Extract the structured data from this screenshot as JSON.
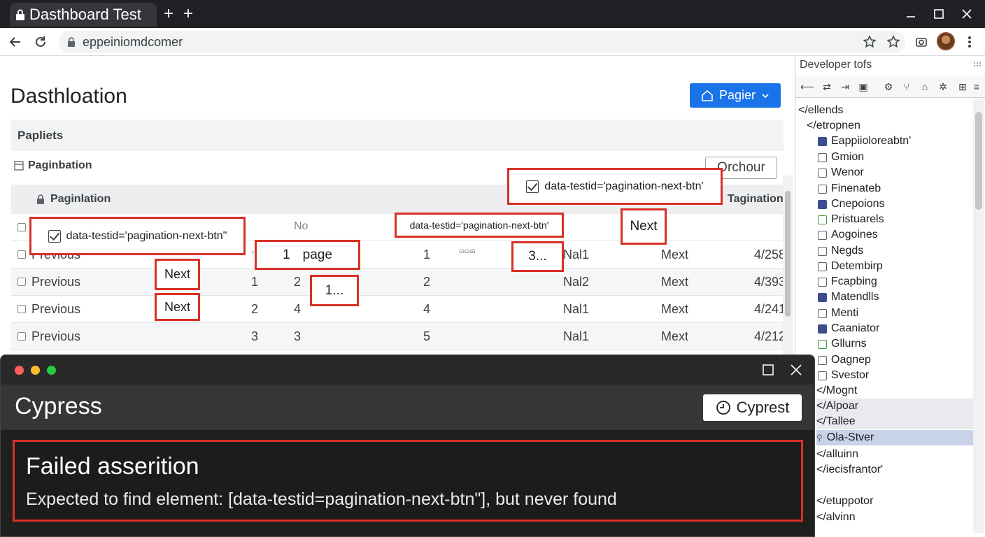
{
  "browser": {
    "tab_title": "Dasthboard Test",
    "url": "eppeiniomdcomer"
  },
  "page": {
    "title": "Dasthloation",
    "primary_button": "Pagier",
    "section_header": "Papliets",
    "subsection": "Paginbation",
    "outline_button": "Orchour",
    "grid_header_left": "Paginlation",
    "grid_header_right": "Tagination",
    "header_row": {
      "no": "No"
    },
    "rows": [
      {
        "c0": "Previous",
        "c1": "1",
        "c2": "1",
        "c3": "1",
        "c4": "Nal1",
        "c5": "Mext",
        "c6": "4/258"
      },
      {
        "c0": "Previous",
        "c1": "1",
        "c2": "2",
        "c3": "2",
        "c4": "Nal2",
        "c5": "Mext",
        "c6": "4/393"
      },
      {
        "c0": "Previous",
        "c1": "2",
        "c2": "4",
        "c3": "4",
        "c4": "Nal1",
        "c5": "Mext",
        "c6": "4/241"
      },
      {
        "c0": "Previous",
        "c1": "3",
        "c2": "3",
        "c3": "5",
        "c4": "Nal1",
        "c5": "Mext",
        "c6": "4/212"
      }
    ],
    "annotations": {
      "testid_top": "data-testid='pagination-next-btn'",
      "testid_left": "data-testid='pagination-next-btn\"",
      "testid_mid": "data-testid='pagination-next-btn'",
      "next_right": "Next",
      "page_label": "page",
      "page_num": "1",
      "three": "3...",
      "one": "1...",
      "next_a": "Next",
      "next_b": "Next"
    }
  },
  "devtools": {
    "title": "Developer tofs",
    "nodes": [
      {
        "text": "</ellends",
        "icon": ""
      },
      {
        "text": "</etropnen",
        "icon": ""
      },
      {
        "text": "Eappiioloreabtn'",
        "icon": "blue"
      },
      {
        "text": "Gmion",
        "icon": "plain"
      },
      {
        "text": "Wenor",
        "icon": "plain"
      },
      {
        "text": "Finenateb",
        "icon": "plain"
      },
      {
        "text": "Cnepoions",
        "icon": "blue"
      },
      {
        "text": "Pristuarels",
        "icon": "green"
      },
      {
        "text": "Aogoines",
        "icon": "plain"
      },
      {
        "text": "Negds",
        "icon": "plain"
      },
      {
        "text": "Detembirp",
        "icon": "plain"
      },
      {
        "text": "Fcapbing",
        "icon": "plain"
      },
      {
        "text": "Matendlls",
        "icon": "blue"
      },
      {
        "text": "Menti",
        "icon": "plain"
      },
      {
        "text": "Caaniator",
        "icon": "blue"
      },
      {
        "text": "Gllurns",
        "icon": "green"
      },
      {
        "text": "Oagnep",
        "icon": "plain"
      },
      {
        "text": "Svestor",
        "icon": "plain"
      },
      {
        "text": "</Mognt",
        "icon": ""
      },
      {
        "text": "</Alpoar",
        "icon": ""
      },
      {
        "text": "</Tallee",
        "icon": ""
      },
      {
        "text": "Ola-Stver",
        "icon": ""
      },
      {
        "text": "</alluinn",
        "icon": ""
      },
      {
        "text": "</iecisfrantor'",
        "icon": ""
      },
      {
        "text": "</etuppotor",
        "icon": ""
      },
      {
        "text": "</alvinn",
        "icon": ""
      }
    ]
  },
  "cypress": {
    "window_title": "Cypress",
    "button": "Cyprest",
    "error_title": "Failed asserition",
    "error_message": "Expected to find element: [data-testid=pagination-next-btn\"], but never found"
  },
  "colors": {
    "accent": "#1a73e8",
    "error": "#d93025",
    "selected": "#c8d3e8"
  }
}
